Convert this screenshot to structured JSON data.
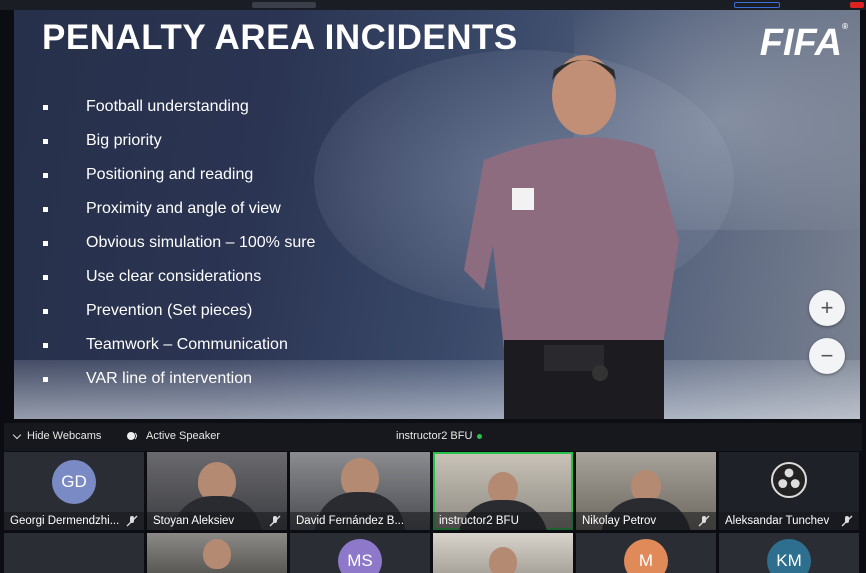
{
  "slide": {
    "title": "PENALTY AREA INCIDENTS",
    "logo": "FIFA",
    "bullets": [
      "Football understanding",
      "Big priority",
      "Positioning and reading",
      "Proximity and angle of view",
      "Obvious simulation – 100% sure",
      "Use clear considerations",
      "Prevention (Set pieces)",
      "Teamwork – Communication",
      "VAR line of intervention"
    ]
  },
  "zoom": {
    "in_label": "+",
    "out_label": "−"
  },
  "toolbar": {
    "hide_webcams": "Hide Webcams",
    "active_speaker": "Active Speaker",
    "current_presenter": "instructor2 BFU",
    "live_color": "#27c24c"
  },
  "participants": [
    {
      "name": "Georgi Dermendzhi...",
      "initials": "GD",
      "avatar_color": "#7a8ac4",
      "muted": true
    },
    {
      "name": "Stoyan Aleksiev",
      "muted": true
    },
    {
      "name": "David Fernández B...",
      "muted": false
    },
    {
      "name": "instructor2 BFU",
      "muted": false,
      "active": true
    },
    {
      "name": "Nikolay Petrov",
      "muted": true
    },
    {
      "name": "Aleksandar Tunchev",
      "muted": true
    }
  ],
  "participants_row2": [
    {
      "initials": ""
    },
    {
      "initials": ""
    },
    {
      "initials": "MS",
      "avatar_color": "#8e78c9"
    },
    {
      "initials": ""
    },
    {
      "initials": "M",
      "avatar_color": "#e08a5a"
    },
    {
      "initials": "KM",
      "avatar_color": "#2e6e8e"
    }
  ]
}
